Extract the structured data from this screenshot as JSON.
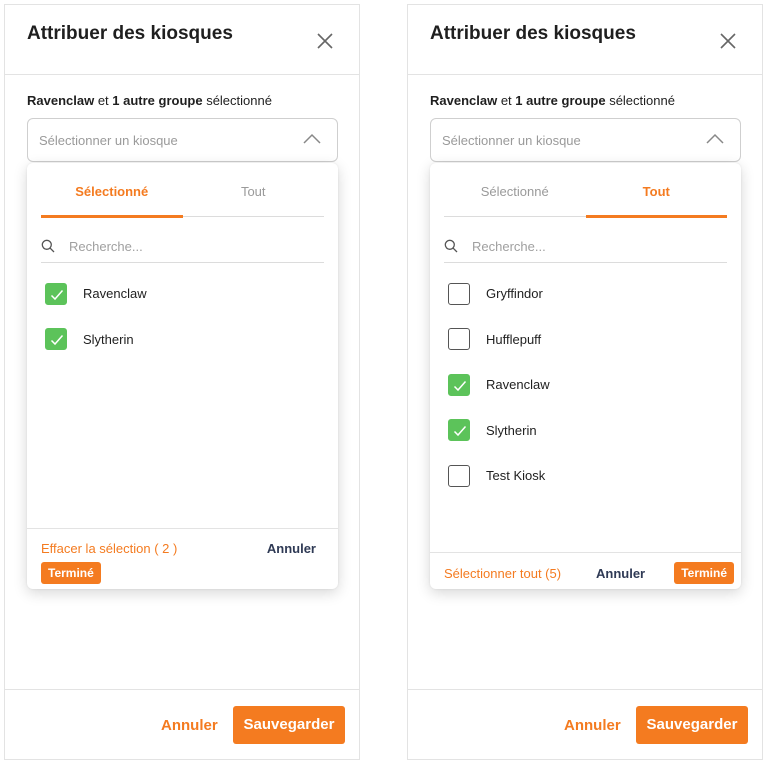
{
  "colors": {
    "accent": "#f47b20",
    "check": "#5cc35a",
    "dark_text": "#2f3a55"
  },
  "panels": [
    {
      "title": "Attribuer des kiosques",
      "summary": {
        "group": "Ravenclaw",
        "connector": " et ",
        "count_text": "1 autre groupe",
        "suffix": " sélectionné"
      },
      "select_placeholder": "Sélectionner un kiosque",
      "tabs": [
        {
          "label": "Sélectionné",
          "active": true
        },
        {
          "label": "Tout",
          "active": false
        }
      ],
      "search_placeholder": "Recherche...",
      "options": [
        {
          "label": "Ravenclaw",
          "checked": true
        },
        {
          "label": "Slytherin",
          "checked": true
        }
      ],
      "footer": {
        "clear": "Effacer la sélection ( 2 )",
        "cancel": "Annuler",
        "done": "Terminé"
      },
      "modal_footer": {
        "cancel": "Annuler",
        "save": "Sauvegarder"
      }
    },
    {
      "title": "Attribuer des kiosques",
      "summary": {
        "group": "Ravenclaw",
        "connector": " et ",
        "count_text": "1 autre groupe",
        "suffix": " sélectionné"
      },
      "select_placeholder": "Sélectionner un kiosque",
      "tabs": [
        {
          "label": "Sélectionné",
          "active": false
        },
        {
          "label": "Tout",
          "active": true
        }
      ],
      "search_placeholder": "Recherche...",
      "options": [
        {
          "label": "Gryffindor",
          "checked": false
        },
        {
          "label": "Hufflepuff",
          "checked": false
        },
        {
          "label": "Ravenclaw",
          "checked": true
        },
        {
          "label": "Slytherin",
          "checked": true
        },
        {
          "label": "Test Kiosk",
          "checked": false
        }
      ],
      "footer": {
        "select_all": "Sélectionner tout (5)",
        "cancel": "Annuler",
        "done": "Terminé"
      },
      "modal_footer": {
        "cancel": "Annuler",
        "save": "Sauvegarder"
      }
    }
  ]
}
